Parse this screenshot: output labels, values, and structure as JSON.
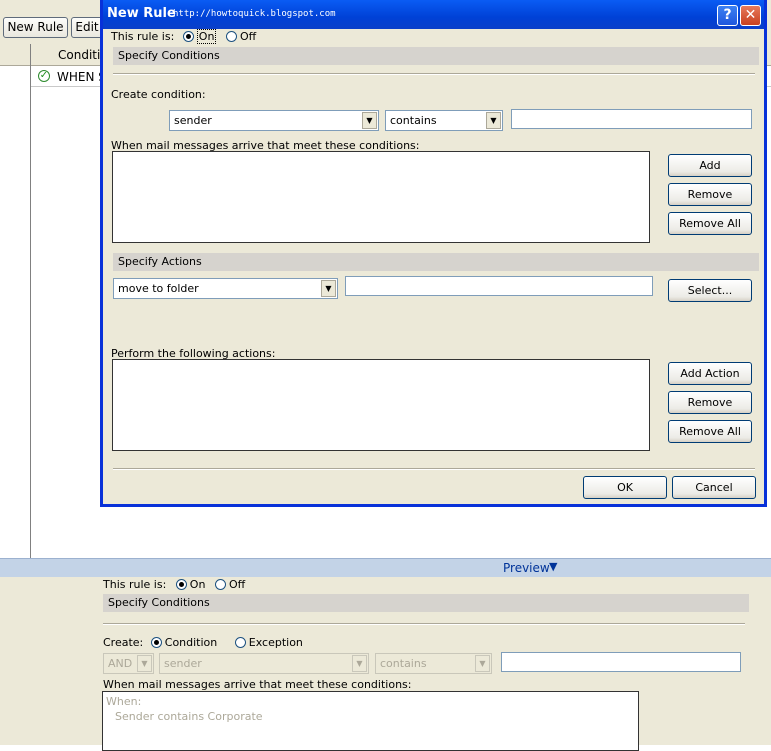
{
  "background_app": {
    "toolbar": {
      "new_rule_label": "New Rule",
      "edit_label": "Edit"
    },
    "column_header": {
      "conditions_label": "Conditio"
    },
    "rule_row": {
      "text": "WHEN S"
    },
    "preview": {
      "label": "Preview",
      "rule_is_label": "This rule is:",
      "on_label": "On",
      "off_label": "Off",
      "specify_conditions_label": "Specify Conditions",
      "create_label": "Create:",
      "condition_label": "Condition",
      "exception_label": "Exception",
      "and_value": "AND",
      "field_value": "sender",
      "operator_value": "contains",
      "when_label": "When mail messages arrive that meet these conditions:",
      "list_header": "When:",
      "list_item": "Sender contains Corporate"
    }
  },
  "dialog": {
    "title": "New Rule",
    "watermark": "http://howtoquick.blogspot.com",
    "help_glyph": "?",
    "close_glyph": "✕",
    "rule_is_label": "This rule is:",
    "on_label": "On",
    "off_label": "Off",
    "rule_state": "On",
    "specify_conditions_label": "Specify Conditions",
    "create_condition_label": "Create condition:",
    "condition_field_value": "sender",
    "condition_operator_value": "contains",
    "condition_value": "",
    "conditions_list_label": "When mail messages arrive that meet these conditions:",
    "add_label": "Add",
    "remove_label": "Remove",
    "remove_all_label": "Remove All",
    "specify_actions_label": "Specify Actions",
    "action_value": "move to folder",
    "action_target_value": "",
    "select_label": "Select...",
    "actions_list_label": "Perform the following actions:",
    "add_action_label": "Add Action",
    "remove_action_label": "Remove",
    "remove_all_actions_label": "Remove All",
    "ok_label": "OK",
    "cancel_label": "Cancel"
  }
}
